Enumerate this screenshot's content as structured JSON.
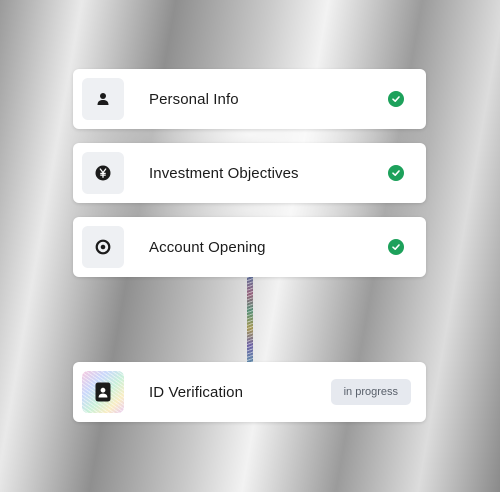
{
  "steps": [
    {
      "label": "Personal Info",
      "icon": "person-icon",
      "status": "complete"
    },
    {
      "label": "Investment Objectives",
      "icon": "yen-icon",
      "status": "complete"
    },
    {
      "label": "Account Opening",
      "icon": "target-icon",
      "status": "complete"
    },
    {
      "label": "ID Verification",
      "icon": "id-card-icon",
      "status": "in progress",
      "badge": "in progress"
    }
  ],
  "colors": {
    "check": "#1da15b",
    "badge_bg": "#e6e9ef",
    "badge_text": "#59606b",
    "icon_box": "#eef0f3"
  }
}
